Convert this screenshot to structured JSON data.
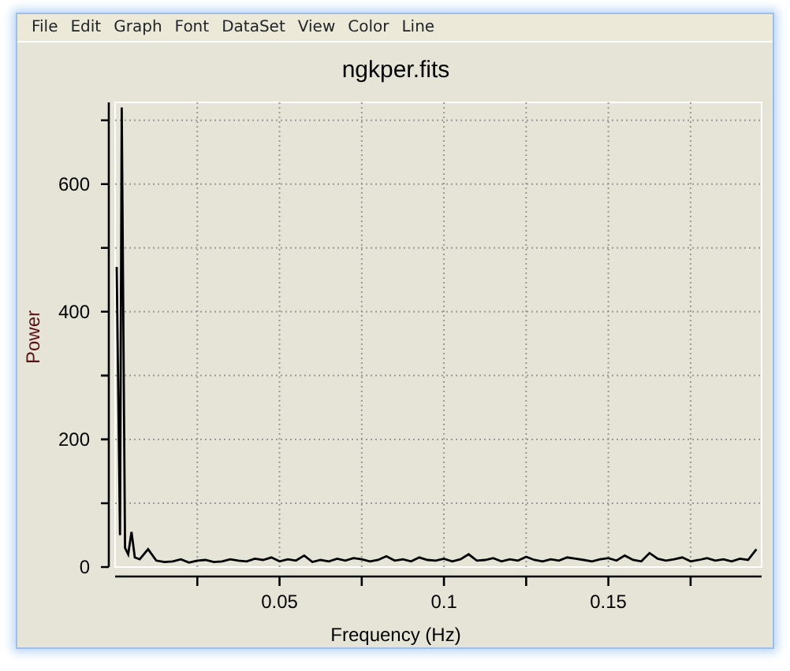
{
  "menu": [
    "File",
    "Edit",
    "Graph",
    "Font",
    "DataSet",
    "View",
    "Color",
    "Line"
  ],
  "chart_data": {
    "type": "line",
    "title": "ngkper.fits",
    "xlabel": "Frequency (Hz)",
    "ylabel": "Power",
    "xlim": [
      0,
      0.1966
    ],
    "ylim": [
      0,
      728
    ],
    "xticks": [
      0.05,
      0.1,
      0.15
    ],
    "yticks": [
      0,
      200,
      400,
      600
    ],
    "x": [
      0.0005,
      0.0015,
      0.002,
      0.003,
      0.004,
      0.005,
      0.006,
      0.0075,
      0.01,
      0.0125,
      0.015,
      0.0175,
      0.02,
      0.0225,
      0.025,
      0.0275,
      0.03,
      0.0325,
      0.035,
      0.0375,
      0.04,
      0.0425,
      0.045,
      0.0475,
      0.05,
      0.0525,
      0.055,
      0.0575,
      0.06,
      0.0625,
      0.065,
      0.0675,
      0.07,
      0.0725,
      0.075,
      0.0775,
      0.08,
      0.0825,
      0.085,
      0.0875,
      0.09,
      0.0925,
      0.095,
      0.0975,
      0.1,
      0.1025,
      0.105,
      0.1075,
      0.11,
      0.1125,
      0.115,
      0.1175,
      0.12,
      0.1225,
      0.125,
      0.1275,
      0.13,
      0.1325,
      0.135,
      0.1375,
      0.14,
      0.1425,
      0.145,
      0.1475,
      0.15,
      0.1525,
      0.155,
      0.1575,
      0.16,
      0.1625,
      0.165,
      0.1675,
      0.17,
      0.1725,
      0.175,
      0.1775,
      0.18,
      0.1825,
      0.185,
      0.1875,
      0.19,
      0.1925,
      0.195
    ],
    "grid": true,
    "series": [
      {
        "color": "#000000",
        "values": [
          470,
          50,
          720,
          30,
          20,
          55,
          15,
          12,
          28,
          10,
          8,
          9,
          12,
          7,
          10,
          11,
          8,
          9,
          12,
          10,
          9,
          13,
          11,
          15,
          9,
          12,
          10,
          18,
          8,
          11,
          9,
          13,
          10,
          14,
          12,
          9,
          11,
          17,
          10,
          12,
          9,
          15,
          11,
          10,
          13,
          9,
          12,
          20,
          10,
          11,
          14,
          9,
          12,
          10,
          16,
          11,
          9,
          12,
          10,
          15,
          13,
          11,
          9,
          12,
          14,
          10,
          18,
          11,
          9,
          22,
          13,
          10,
          12,
          15,
          9,
          11,
          14,
          10,
          12,
          9,
          13,
          11,
          28
        ]
      }
    ]
  }
}
